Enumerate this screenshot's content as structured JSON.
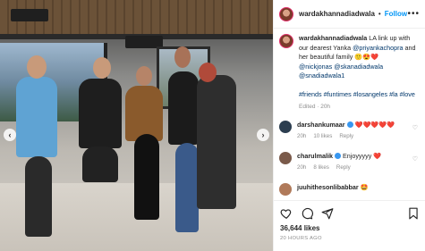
{
  "post": {
    "username": "wardakhannadiadwala",
    "follow_label": "Follow",
    "more_label": "•••",
    "caption": {
      "username": "wardakhannadiadwala",
      "text_1": "LA link up with our dearest Yanka",
      "mention_1": "@priyankachopra",
      "text_2": "and her beautiful family",
      "emojis": "🙂😍❤️",
      "mention_2": "@nickjonas",
      "mention_3": "@skanadiadwala",
      "mention_4": "@snadiadwala1",
      "hashtags": "#friends #funtimes #losangeles #la #love",
      "edited": "Edited · 20h"
    },
    "comments": [
      {
        "username": "darshankumaar",
        "text": "❤️❤️❤️❤️❤️",
        "time": "20h",
        "likes": "10 likes",
        "reply": "Reply",
        "avatar_color": "#2c3e50"
      },
      {
        "username": "charulmalik",
        "text": "Enjoyyyyy ❤️",
        "time": "20h",
        "likes": "8 likes",
        "reply": "Reply",
        "avatar_color": "#7a5a4a"
      },
      {
        "username": "juuhithesonlibabbar",
        "text": "🤩",
        "avatar_color": "#b07a5a"
      }
    ],
    "likes": "36,644 likes",
    "timestamp": "20 HOURS AGO"
  },
  "icons": [
    "heart-icon",
    "comment-icon",
    "share-icon",
    "bookmark-icon",
    "chevron-left-icon",
    "chevron-right-icon"
  ],
  "colors": {
    "link": "#0095f6",
    "mention": "#00376b",
    "muted": "#8e8e8e",
    "heart": "#ed4956"
  }
}
